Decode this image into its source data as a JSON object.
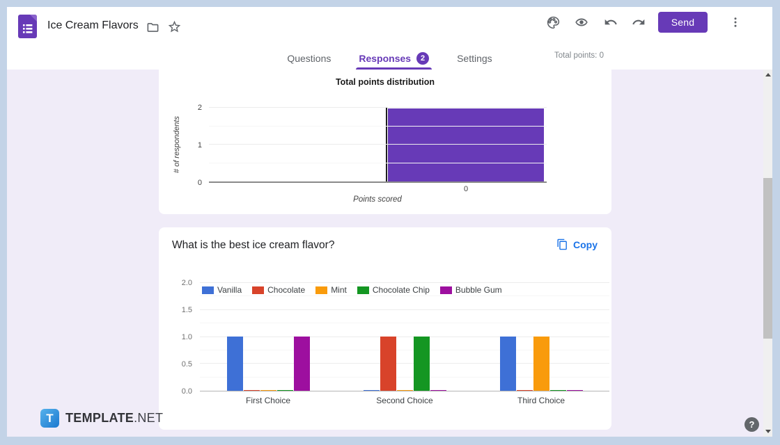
{
  "header": {
    "title": "Ice Cream Flavors",
    "send_label": "Send",
    "icons": [
      "forms-logo",
      "folder",
      "star",
      "palette",
      "preview-eye",
      "undo",
      "redo",
      "kebab-menu"
    ]
  },
  "tabs": {
    "items": [
      {
        "label": "Questions",
        "active": false
      },
      {
        "label": "Responses",
        "active": true,
        "badge": "2"
      },
      {
        "label": "Settings",
        "active": false
      }
    ],
    "total_points": "Total points: 0"
  },
  "chart_data": [
    {
      "type": "bar",
      "title": "Total points distribution",
      "xlabel": "Points scored",
      "ylabel": "# of respondents",
      "categories": [
        "0"
      ],
      "values": [
        2
      ],
      "ylim": [
        0,
        2
      ],
      "yticks": [
        0,
        1,
        2
      ],
      "bar_color": "#673ab7",
      "grid": true,
      "legend_position": "none"
    },
    {
      "type": "bar",
      "title": "What is the best ice cream flavor?",
      "categories": [
        "First Choice",
        "Second Choice",
        "Third Choice"
      ],
      "series": [
        {
          "name": "Vanilla",
          "color": "#3e70d6",
          "values": [
            1,
            0,
            1
          ]
        },
        {
          "name": "Chocolate",
          "color": "#d8432a",
          "values": [
            0,
            1,
            0
          ]
        },
        {
          "name": "Mint",
          "color": "#f99b0c",
          "values": [
            0,
            0,
            1
          ]
        },
        {
          "name": "Chocolate Chip",
          "color": "#149622",
          "values": [
            0,
            1,
            0
          ]
        },
        {
          "name": "Bubble Gum",
          "color": "#9d0f9f",
          "values": [
            1,
            0,
            0
          ]
        }
      ],
      "ylim": [
        0,
        2
      ],
      "yticks": [
        "0.0",
        "0.5",
        "1.0",
        "1.5",
        "2.0"
      ],
      "minor_ticks": [
        0.25,
        0.75,
        1.25,
        1.75
      ],
      "grid": true,
      "legend_position": "top"
    }
  ],
  "question_card": {
    "question": "What is the best ice cream flavor?",
    "copy_label": "Copy"
  },
  "footer": {
    "brand_bold": "TEMPLATE",
    "brand_rest": ".NET",
    "help_label": "?"
  },
  "colors": {
    "accent_purple": "#673ab7",
    "copy_blue": "#1a73e8",
    "frame_blue": "#c3d3e7",
    "page_bg": "#f0ecf8"
  }
}
